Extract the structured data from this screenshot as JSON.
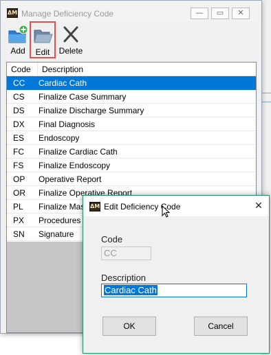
{
  "main_window": {
    "title": "Manage Deficiency Code",
    "app_icon_text": "ΔM",
    "controls": {
      "minimize": "—",
      "maximize": "▭",
      "close": "✕"
    }
  },
  "toolbar": {
    "add_label": "Add",
    "edit_label": "Edit",
    "delete_label": "Delete"
  },
  "list": {
    "columns": [
      "Code",
      "Description"
    ],
    "selected_index": 0,
    "rows": [
      {
        "code": "CC",
        "description": "Cardiac Cath"
      },
      {
        "code": "CS",
        "description": "Finalize Case Summary"
      },
      {
        "code": "DS",
        "description": "Finalize Discharge Summary"
      },
      {
        "code": "DX",
        "description": "Final Diagnosis"
      },
      {
        "code": "ES",
        "description": "Endoscopy"
      },
      {
        "code": "FC",
        "description": "Finalize Cardiac Cath"
      },
      {
        "code": "FS",
        "description": "Finalize Endoscopy"
      },
      {
        "code": "OP",
        "description": "Operative Report"
      },
      {
        "code": "OR",
        "description": "Finalize Operative Report"
      },
      {
        "code": "PL",
        "description": "Finalize Maste"
      },
      {
        "code": "PX",
        "description": "Procedures"
      },
      {
        "code": "SN",
        "description": "Signature"
      }
    ]
  },
  "dialog": {
    "title": "Edit Deficiency Code",
    "close": "✕",
    "code_label": "Code",
    "code_value": "CC",
    "description_label": "Description",
    "description_value": "Cardiac Cath",
    "ok_label": "OK",
    "cancel_label": "Cancel"
  },
  "colors": {
    "selection": "#0078d7",
    "highlight_border": "#e05050",
    "dialog_border": "#1f8f6f"
  }
}
